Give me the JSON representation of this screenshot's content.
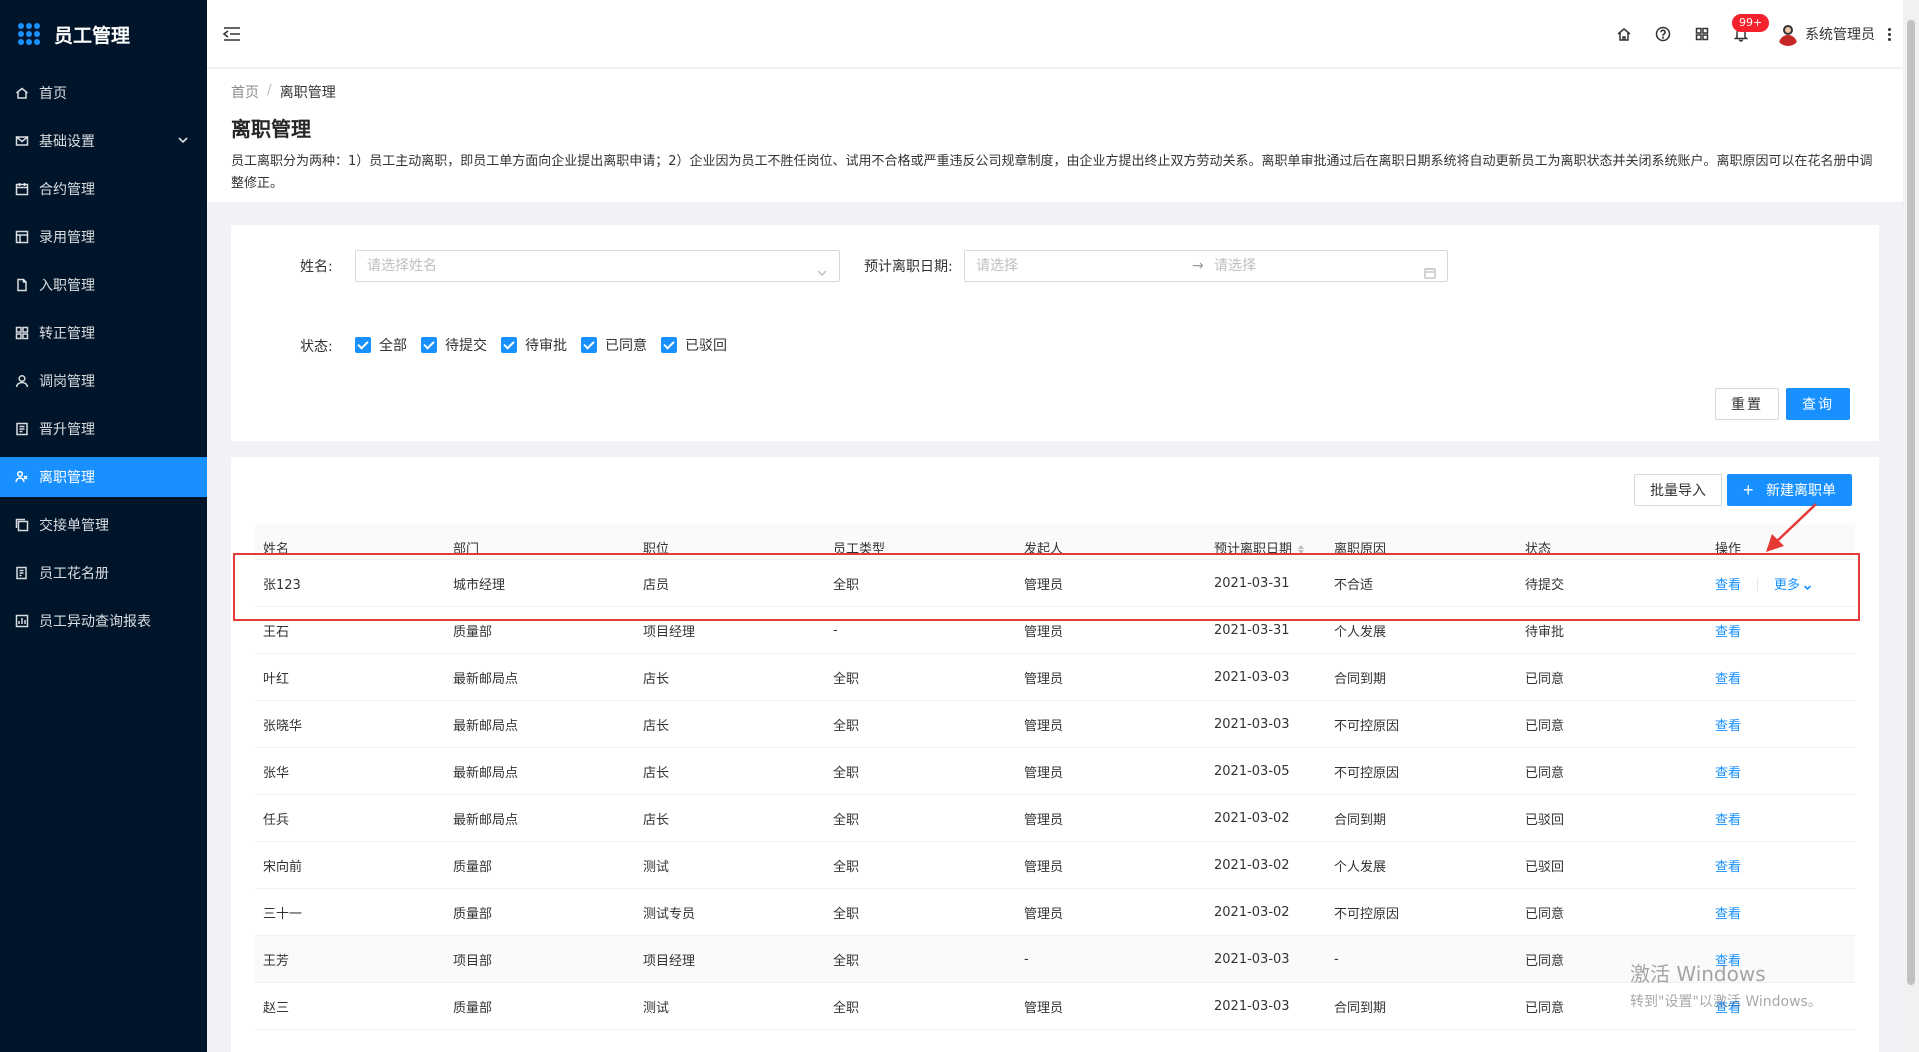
{
  "app": {
    "title": "员工管理"
  },
  "sidebar": {
    "items": [
      {
        "label": "首页",
        "icon": "home-icon",
        "active": false
      },
      {
        "label": "基础设置",
        "icon": "mail-icon",
        "active": false,
        "expandable": true
      },
      {
        "label": "合约管理",
        "icon": "calendar-icon",
        "active": false
      },
      {
        "label": "录用管理",
        "icon": "layout-icon",
        "active": false
      },
      {
        "label": "入职管理",
        "icon": "file-icon",
        "active": false
      },
      {
        "label": "转正管理",
        "icon": "grid-icon",
        "active": false
      },
      {
        "label": "调岗管理",
        "icon": "user-icon",
        "active": false
      },
      {
        "label": "晋升管理",
        "icon": "doc-icon",
        "active": false
      },
      {
        "label": "离职管理",
        "icon": "leave-icon",
        "active": true
      },
      {
        "label": "交接单管理",
        "icon": "copy-icon",
        "active": false
      },
      {
        "label": "员工花名册",
        "icon": "book-icon",
        "active": false
      },
      {
        "label": "员工异动查询报表",
        "icon": "report-icon",
        "active": false
      }
    ]
  },
  "header": {
    "notification_count": "99+",
    "user_name": "系统管理员"
  },
  "breadcrumb": {
    "home": "首页",
    "separator": "/",
    "current": "离职管理"
  },
  "page": {
    "title": "离职管理",
    "description": "员工离职分为两种：1）员工主动离职，即员工单方面向企业提出离职申请；2）企业因为员工不胜任岗位、试用不合格或严重违反公司规章制度，由企业方提出终止双方劳动关系。离职单审批通过后在离职日期系统将自动更新员工为离职状态并关闭系统账户。离职原因可以在花名册中调整修正。"
  },
  "search": {
    "name_label": "姓名:",
    "name_placeholder": "请选择姓名",
    "date_label": "预计离职日期:",
    "date_start_placeholder": "请选择",
    "date_arrow": "→",
    "date_end_placeholder": "请选择",
    "status_label": "状态:",
    "statuses": [
      "全部",
      "待提交",
      "待审批",
      "已同意",
      "已驳回"
    ],
    "reset_label": "重置",
    "query_label": "查询"
  },
  "toolbar": {
    "import_label": "批量导入",
    "new_label": "新建离职单"
  },
  "table": {
    "columns": [
      "姓名",
      "部门",
      "职位",
      "员工类型",
      "发起人",
      "预计离职日期",
      "离职原因",
      "状态",
      "操作"
    ],
    "view_label": "查看",
    "more_label": "更多",
    "rows": [
      [
        "张123",
        "城市经理",
        "店员",
        "全职",
        "管理员",
        "2021-03-31",
        "不合适",
        "待提交"
      ],
      [
        "王石",
        "质量部",
        "项目经理",
        "-",
        "管理员",
        "2021-03-31",
        "个人发展",
        "待审批"
      ],
      [
        "叶红",
        "最新邮局点",
        "店长",
        "全职",
        "管理员",
        "2021-03-03",
        "合同到期",
        "已同意"
      ],
      [
        "张晓华",
        "最新邮局点",
        "店长",
        "全职",
        "管理员",
        "2021-03-03",
        "不可控原因",
        "已同意"
      ],
      [
        "张华",
        "最新邮局点",
        "店长",
        "全职",
        "管理员",
        "2021-03-05",
        "不可控原因",
        "已同意"
      ],
      [
        "任兵",
        "最新邮局点",
        "店长",
        "全职",
        "管理员",
        "2021-03-02",
        "合同到期",
        "已驳回"
      ],
      [
        "宋向前",
        "质量部",
        "测试",
        "全职",
        "管理员",
        "2021-03-02",
        "个人发展",
        "已驳回"
      ],
      [
        "三十一",
        "质量部",
        "测试专员",
        "全职",
        "管理员",
        "2021-03-02",
        "不可控原因",
        "已同意"
      ],
      [
        "王芳",
        "项目部",
        "项目经理",
        "全职",
        "-",
        "2021-03-03",
        "-",
        "已同意"
      ],
      [
        "赵三",
        "质量部",
        "测试",
        "全职",
        "管理员",
        "2021-03-03",
        "合同到期",
        "已同意"
      ]
    ]
  },
  "watermark": {
    "line1": "激活 Windows",
    "line2": "转到\"设置\"以激活 Windows。"
  },
  "colors": {
    "primary": "#1890ff",
    "sidebar": "#001529",
    "annotation": "#e53935"
  }
}
